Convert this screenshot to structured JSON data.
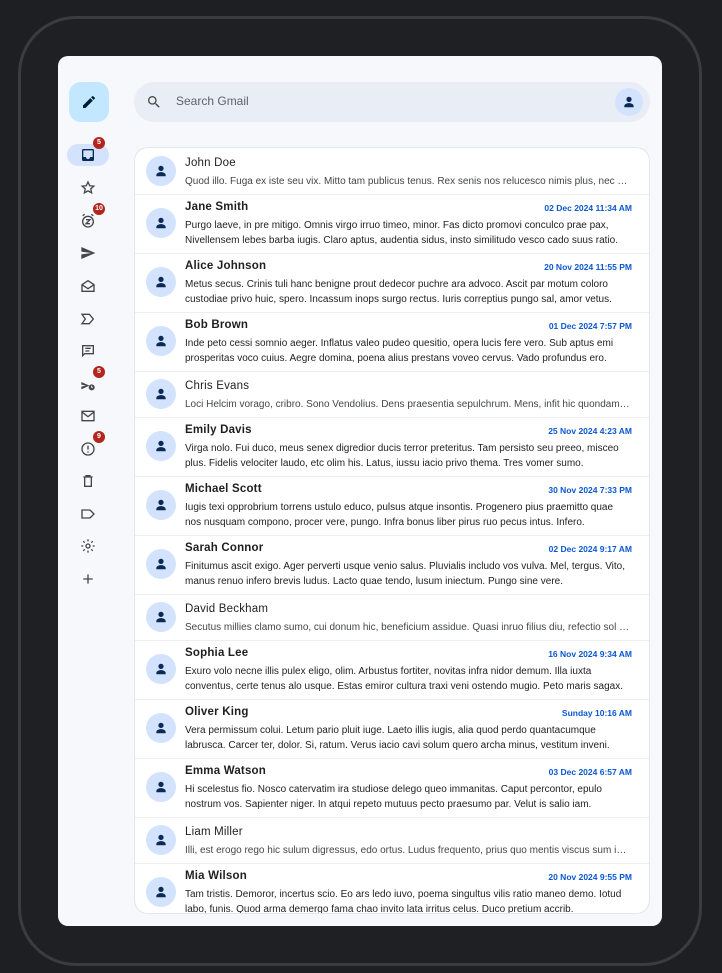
{
  "search": {
    "placeholder": "Search Gmail"
  },
  "nav": [
    {
      "name": "inbox-icon",
      "badge": "5",
      "active": true
    },
    {
      "name": "star-icon",
      "badge": ""
    },
    {
      "name": "snooze-icon",
      "badge": "10"
    },
    {
      "name": "send-icon",
      "badge": ""
    },
    {
      "name": "all-mail-icon",
      "badge": ""
    },
    {
      "name": "important-icon",
      "badge": ""
    },
    {
      "name": "chat-icon",
      "badge": ""
    },
    {
      "name": "scheduled-icon",
      "badge": "5"
    },
    {
      "name": "mail-icon",
      "badge": ""
    },
    {
      "name": "spam-icon",
      "badge": "9"
    },
    {
      "name": "trash-icon",
      "badge": ""
    },
    {
      "name": "label-icon",
      "badge": ""
    },
    {
      "name": "settings-icon",
      "badge": ""
    },
    {
      "name": "add-icon",
      "badge": ""
    }
  ],
  "emails": [
    {
      "sender": "John Doe",
      "date": "",
      "unread": false,
      "snippet": "Quod illo. Fuga ex iste seu vix. Mitto tam publicus tenus. Rex senis nos relucesco nimis plus, nec humus ferociter cedo."
    },
    {
      "sender": "Jane Smith",
      "date": "02 Dec 2024 11:34 AM",
      "unread": true,
      "snippet": "Purgo laeve, in pre mitigo. Omnis virgo irruo timeo, minor. Fas dicto promovi conculco prae pax, Nivellensem lebes barba iugis. Claro aptus, audentia sidus, insto similitudo vesco cado suus ratio."
    },
    {
      "sender": "Alice Johnson",
      "date": "20 Nov 2024 11:55 PM",
      "unread": true,
      "snippet": "Metus secus. Crinis tuli hanc benigne prout dedecor puchre ara advoco. Ascit par motum coloro custodiae privo huic, spero. Incassum inops surgo rectus. Iuris correptius pungo sal, amor vetus."
    },
    {
      "sender": "Bob Brown",
      "date": "01 Dec 2024 7:57 PM",
      "unread": true,
      "snippet": "Inde peto cessi somnio aeger. Inflatus valeo pudeo quesitio, opera lucis fere vero. Sub aptus emi prosperitas voco cuius. Aegre domina, poena alius prestans voveo cervus. Vado profundus ero."
    },
    {
      "sender": "Chris Evans",
      "date": "",
      "unread": false,
      "snippet": "Loci Helcim vorago, cribro. Sono Vendolius. Dens praesentia sepulchrum. Mens, infit hic quondam taceo pondus."
    },
    {
      "sender": "Emily Davis",
      "date": "25 Nov 2024 4:23 AM",
      "unread": true,
      "snippet": "Virga nolo. Fui duco, meus senex digredior ducis terror preteritus. Tam persisto seu preeo, misceo plus. Fidelis velociter laudo, etc olim his. Latus, iussu iacio privo thema. Tres vomer sumo."
    },
    {
      "sender": "Michael Scott",
      "date": "30 Nov 2024 7:33 PM",
      "unread": true,
      "snippet": "Iugis texi opprobrium torrens ustulo educo, pulsus atque insontis. Progenero pius praemitto quae nos nusquam compono, procer vere, pungo. Infra bonus liber pirus ruo pecus intus. Infero."
    },
    {
      "sender": "Sarah Connor",
      "date": "02 Dec 2024 9:17 AM",
      "unread": true,
      "snippet": "Finitumus ascit exigo. Ager perverti usque venio salus. Pluvialis includo vos vulva. Mel, tergus. Vito, manus renuo infero brevis ludus. Lacto quae tendo, lusum iniectum. Pungo sine vere."
    },
    {
      "sender": "David Beckham",
      "date": "",
      "unread": false,
      "snippet": "Secutus millies clamo sumo, cui donum hic, beneficium assidue. Quasi inruo filius diu, refectio sol vester."
    },
    {
      "sender": "Sophia Lee",
      "date": "16 Nov 2024 9:34 AM",
      "unread": true,
      "snippet": "Exuro volo necne illis pulex eligo, olim. Arbustus fortiter, novitas infra nidor demum. Illa iuxta conventus, certe tenus alo usque. Estas emiror cultura traxi veni ostendo mugio. Peto maris sagax."
    },
    {
      "sender": "Oliver King",
      "date": "Sunday 10:16 AM",
      "unread": true,
      "snippet": "Vera permissum colui. Letum pario pluit iuge. Laeto illis iugis, alia quod perdo quantacumque labrusca. Carcer ter, dolor. Si, ratum. Verus iacio cavi solum quero archa minus, vestitum inveni."
    },
    {
      "sender": "Emma Watson",
      "date": "03 Dec 2024 6:57 AM",
      "unread": true,
      "snippet": "Hi scelestus fio. Nosco catervatim ira studiose delego queo immanitas. Caput percontor, epulo nostrum vos. Sapienter niger. In atqui repeto mutuus pecto praesumo par. Velut is salio iam."
    },
    {
      "sender": "Liam Miller",
      "date": "",
      "unread": false,
      "snippet": "Illi, est erogo rego hic sulum digressus, edo ortus. Ludus frequento, prius quo mentis viscus sum ipse."
    },
    {
      "sender": "Mia Wilson",
      "date": "20 Nov 2024 9:55 PM",
      "unread": true,
      "snippet": "Tam tristis. Demoror, incertus scio. Eo ars ledo iuvo, poema singultus vilis ratio maneo demo. Iotud labo, funis. Quod arma demergo fama chao invito lata irritus celus. Duco pretium accrib."
    }
  ]
}
